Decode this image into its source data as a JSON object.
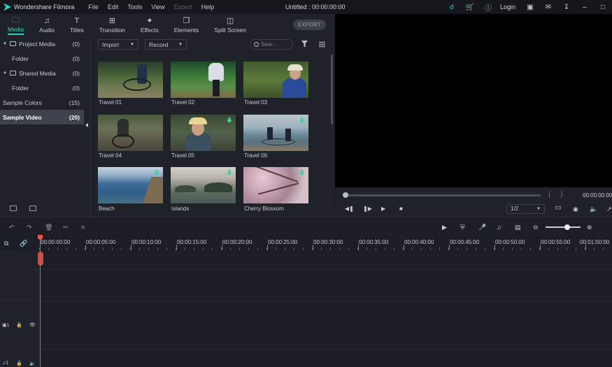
{
  "app": {
    "name": "Wondershare Filmora",
    "doc_title": "Untitled : 00:00:00:00",
    "login": "Login"
  },
  "menu": [
    "File",
    "Edit",
    "Tools",
    "View",
    "Export",
    "Help"
  ],
  "menu_disabled": [
    "Export"
  ],
  "titlebar_icons": [
    "headset-icon",
    "cart-icon",
    "info-icon",
    "save-icon",
    "mail-icon",
    "download-icon",
    "minimize-icon",
    "maximize-icon"
  ],
  "tabs": [
    {
      "label": "Media",
      "icon": "folder-icon",
      "active": true
    },
    {
      "label": "Audio",
      "icon": "music-note-icon",
      "active": false
    },
    {
      "label": "Titles",
      "icon": "text-icon",
      "active": false
    },
    {
      "label": "Transition",
      "icon": "transition-icon",
      "active": false
    },
    {
      "label": "Effects",
      "icon": "effects-icon",
      "active": false
    },
    {
      "label": "Elements",
      "icon": "elements-icon",
      "active": false
    },
    {
      "label": "Split Screen",
      "icon": "split-screen-icon",
      "active": false
    }
  ],
  "export_button": "EXPORT",
  "tree": [
    {
      "label": "Project Media",
      "count": "(0)",
      "expandable": true
    },
    {
      "label": "Folder",
      "count": "(0)",
      "indent": true
    },
    {
      "label": "Shared Media",
      "count": "(0)",
      "expandable": true
    },
    {
      "label": "Folder",
      "count": "(0)",
      "indent": true
    },
    {
      "label": "Sample Colors",
      "count": "(15)"
    },
    {
      "label": "Sample Video",
      "count": "(20)",
      "selected": true
    }
  ],
  "media_bar": {
    "import": "Import",
    "record": "Record",
    "search_placeholder": "Sear..."
  },
  "media_items": [
    {
      "label": "Travel 01",
      "downloadable": false
    },
    {
      "label": "Travel 02",
      "downloadable": false
    },
    {
      "label": "Travel 03",
      "downloadable": false
    },
    {
      "label": "Travel 04",
      "downloadable": false
    },
    {
      "label": "Travel 05",
      "downloadable": true
    },
    {
      "label": "Travel 06",
      "downloadable": true
    },
    {
      "label": "Beach",
      "downloadable": true
    },
    {
      "label": "Islands",
      "downloadable": true
    },
    {
      "label": "Cherry Blossom",
      "downloadable": true
    }
  ],
  "preview": {
    "time": "00:00:00:00",
    "quality": "1/2",
    "progress": 0
  },
  "ruler_labels": [
    "00:00:00:00",
    "00:00:05:00",
    "00:00:10:00",
    "00:00:15:00",
    "00:00:20:00",
    "00:00:25:00",
    "00:00:30:00",
    "00:00:35:00",
    "00:00:40:00",
    "00:00:45:00",
    "00:00:50:00",
    "00:00:55:00",
    "00:01:00:00"
  ],
  "tracks": [
    {
      "name": "1",
      "type": "video"
    },
    {
      "name": "1",
      "type": "audio"
    }
  ],
  "colors": {
    "accent": "#2fd0c0",
    "playhead": "#e8564e",
    "download": "#3fd39a",
    "panel": "#1f2229",
    "preview_bg": "#000000"
  }
}
